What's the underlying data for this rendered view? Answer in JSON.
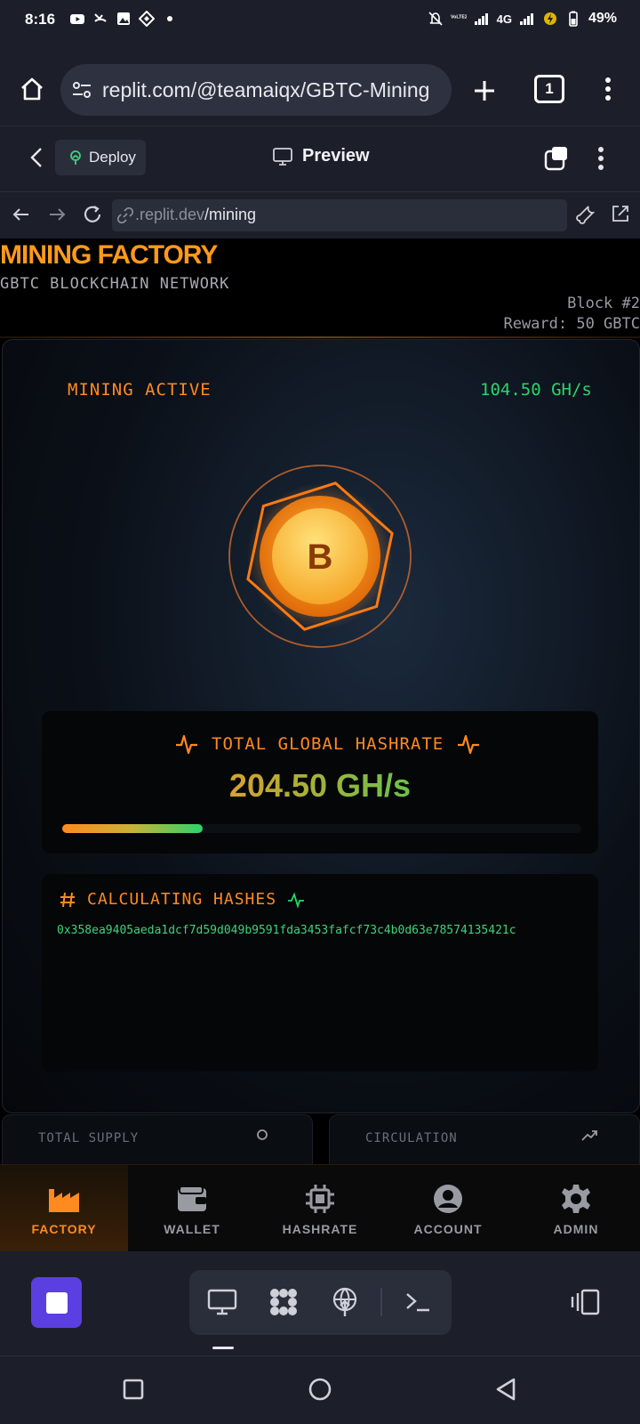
{
  "status_bar": {
    "time": "8:16",
    "network": "4G",
    "battery": "49%"
  },
  "browser": {
    "url": "replit.com/@teamaiqx/GBTC-Mining",
    "tab_count": "1"
  },
  "replit": {
    "deploy_label": "Deploy",
    "preview_label": "Preview",
    "inner_url_host": ".replit.dev",
    "inner_url_path": "/mining"
  },
  "app": {
    "title": "MINING FACTORY",
    "subtitle": "GBTC BLOCKCHAIN NETWORK",
    "block": "Block #2",
    "reward": "Reward: 50 GBTC",
    "status": "MINING ACTIVE",
    "local_rate": "104.50 GH/s",
    "coin_symbol": "B",
    "global_hashrate_title": "TOTAL GLOBAL HASHRATE",
    "global_hashrate_value": "204.50 GH/s",
    "hashrate_progress": 0.27,
    "calc_title": "CALCULATING HASHES",
    "calc_hash": "0x358ea9405aeda1dcf7d59d049b9591fda3453fafcf73c4b0d63e78574135421c",
    "total_supply_label": "TOTAL SUPPLY",
    "circulation_label": "CIRCULATION"
  },
  "nav": {
    "factory": "FACTORY",
    "wallet": "WALLET",
    "hashrate": "HASHRATE",
    "account": "ACCOUNT",
    "admin": "ADMIN"
  },
  "colors": {
    "accent": "#ff8a1f",
    "green": "#2bd46a",
    "replit_stop": "#5b3fe0"
  }
}
